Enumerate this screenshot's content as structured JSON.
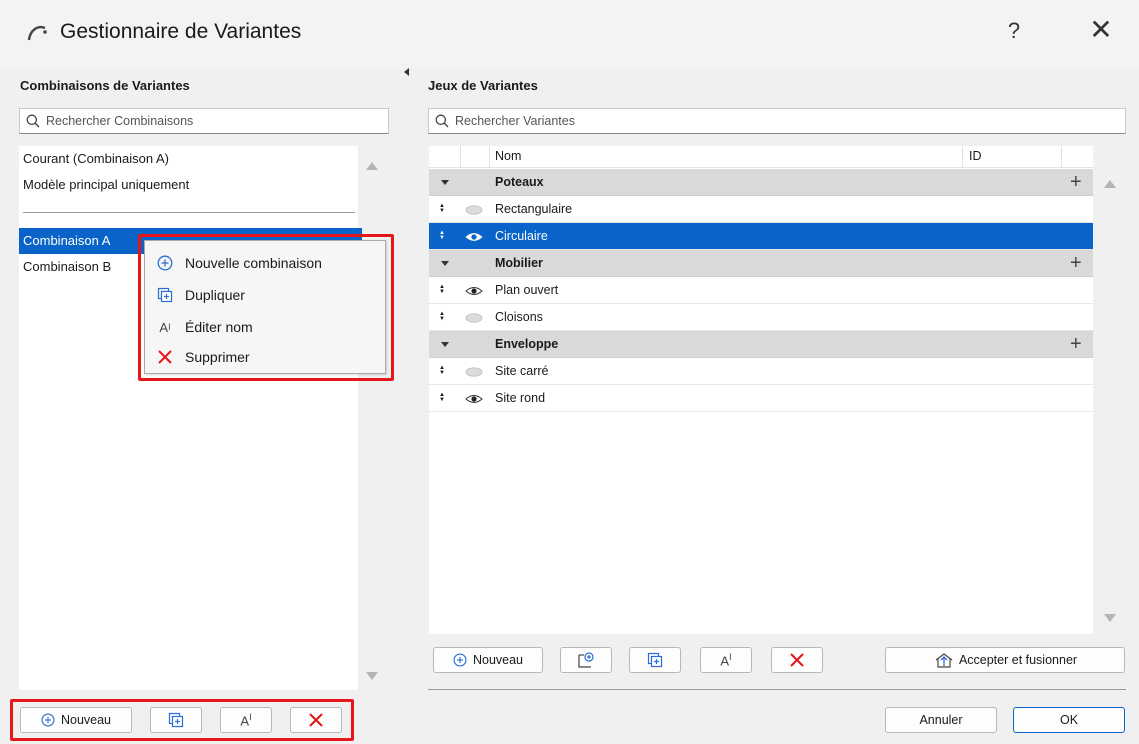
{
  "window": {
    "title": "Gestionnaire de Variantes",
    "help": "?",
    "close": "✕"
  },
  "left": {
    "heading": "Combinaisons de Variantes",
    "search_placeholder": "Rechercher Combinaisons",
    "items_top": [
      "Courant (Combinaison A)",
      "Modèle principal uniquement"
    ],
    "items": [
      "Combinaison A",
      "Combinaison B"
    ],
    "buttons": {
      "new_label": "Nouveau"
    }
  },
  "context_menu": {
    "items": [
      {
        "label": "Nouvelle combinaison",
        "icon": "plus-circle-icon"
      },
      {
        "label": "Dupliquer",
        "icon": "duplicate-icon"
      },
      {
        "label": "Éditer nom",
        "icon": "rename-icon"
      },
      {
        "label": "Supprimer",
        "icon": "delete-x-icon"
      }
    ]
  },
  "right": {
    "heading": "Jeux de Variantes",
    "search_placeholder": "Rechercher Variantes",
    "columns": {
      "name": "Nom",
      "id": "ID"
    },
    "rows": [
      {
        "type": "group",
        "label": "Poteaux"
      },
      {
        "type": "item",
        "label": "Rectangulaire",
        "visible": false
      },
      {
        "type": "item",
        "label": "Circulaire",
        "visible": true,
        "selected": true
      },
      {
        "type": "group",
        "label": "Mobilier"
      },
      {
        "type": "item",
        "label": "Plan ouvert",
        "visible": true
      },
      {
        "type": "item",
        "label": "Cloisons",
        "visible": false
      },
      {
        "type": "group",
        "label": "Enveloppe"
      },
      {
        "type": "item",
        "label": "Site carré",
        "visible": false
      },
      {
        "type": "item",
        "label": "Site rond",
        "visible": true
      }
    ],
    "buttons": {
      "new_label": "Nouveau",
      "accept_merge_label": "Accepter et fusionner"
    }
  },
  "footer": {
    "cancel_label": "Annuler",
    "ok_label": "OK"
  },
  "colors": {
    "selection": "#0a63c9",
    "highlight_frame": "#e5171a",
    "delete_icon": "#e5171a",
    "add_icon": "#2b6fd6"
  }
}
